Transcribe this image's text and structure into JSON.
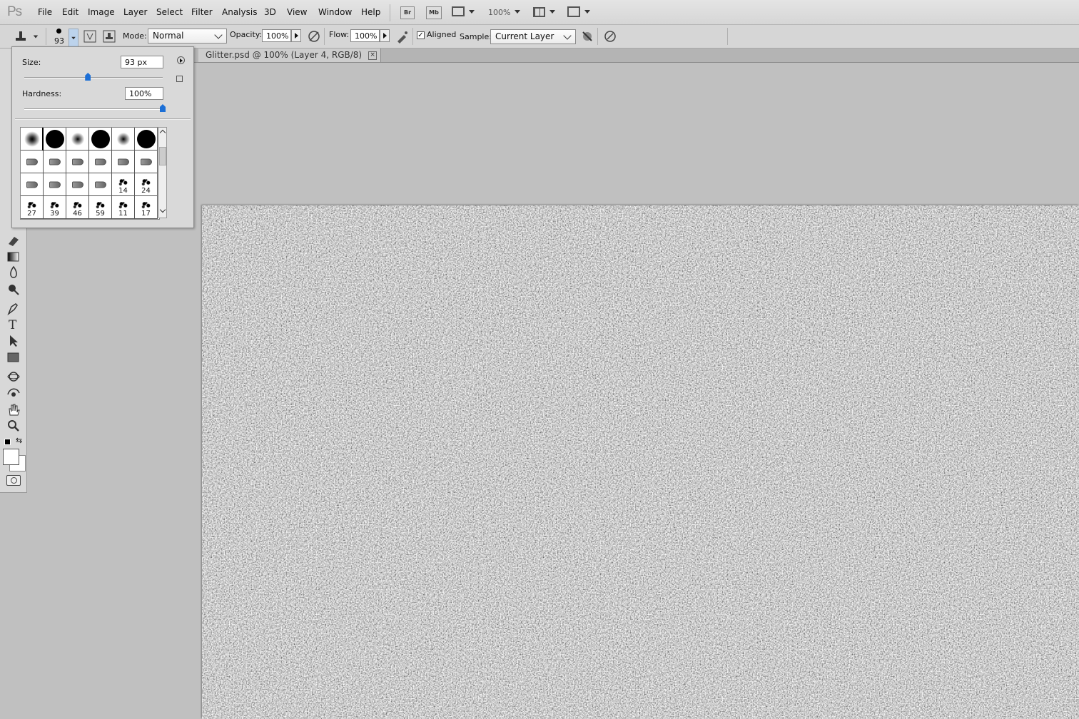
{
  "app": {
    "logo": "Ps"
  },
  "menu": {
    "items": [
      "File",
      "Edit",
      "Image",
      "Layer",
      "Select",
      "Filter",
      "Analysis",
      "3D",
      "View",
      "Window",
      "Help"
    ],
    "bridge": "Br",
    "minibridge": "Mb",
    "zoom": "100%"
  },
  "options": {
    "brush_size": "93",
    "mode_label": "Mode:",
    "mode_value": "Normal",
    "opacity_label": "Opacity:",
    "opacity_value": "100%",
    "flow_label": "Flow:",
    "flow_value": "100%",
    "aligned_label": "Aligned",
    "aligned_checked": true,
    "sample_label": "Sample:",
    "sample_value": "Current Layer"
  },
  "document": {
    "tab_title": "Glitter.psd @ 100% (Layer 4, RGB/8)",
    "close_glyph": "×"
  },
  "brush_picker": {
    "size_label": "Size:",
    "size_value": "93 px",
    "size_fraction": 0.46,
    "hardness_label": "Hardness:",
    "hardness_value": "100%",
    "hardness_fraction": 1.0,
    "presets": [
      {
        "type": "soft",
        "num": ""
      },
      {
        "type": "hard",
        "num": "",
        "selected": true
      },
      {
        "type": "soft-small",
        "num": ""
      },
      {
        "type": "hard",
        "num": ""
      },
      {
        "type": "soft-small",
        "num": ""
      },
      {
        "type": "hard",
        "num": ""
      },
      {
        "type": "tool",
        "num": ""
      },
      {
        "type": "tool",
        "num": ""
      },
      {
        "type": "tool",
        "num": ""
      },
      {
        "type": "tool",
        "num": ""
      },
      {
        "type": "tool",
        "num": ""
      },
      {
        "type": "tool",
        "num": ""
      },
      {
        "type": "tool",
        "num": ""
      },
      {
        "type": "tool",
        "num": ""
      },
      {
        "type": "tool",
        "num": ""
      },
      {
        "type": "tool",
        "num": ""
      },
      {
        "type": "splat",
        "num": "14"
      },
      {
        "type": "splat",
        "num": "24"
      },
      {
        "type": "splat",
        "num": "27"
      },
      {
        "type": "splat",
        "num": "39"
      },
      {
        "type": "splat",
        "num": "46"
      },
      {
        "type": "splat",
        "num": "59"
      },
      {
        "type": "splat",
        "num": "11"
      },
      {
        "type": "splat",
        "num": "17"
      }
    ]
  },
  "toolbox": {
    "tools": [
      "eraser",
      "gradient",
      "blur",
      "dodge",
      "pen",
      "type",
      "path-select",
      "rectangle",
      "3d-rotate",
      "3d-orbit",
      "hand",
      "zoom"
    ]
  },
  "colors": {
    "accent": "#1c6fd6",
    "foreground": "#000000",
    "background": "#ffffff"
  }
}
